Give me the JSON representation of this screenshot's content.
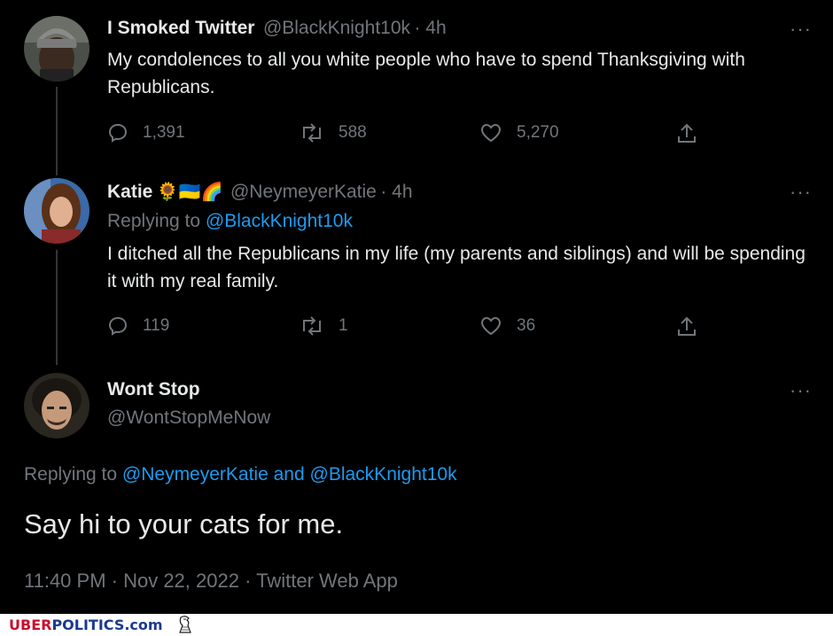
{
  "tweets": [
    {
      "name": "I Smoked Twitter",
      "handle": "@BlackKnight10k",
      "time": "· 4h",
      "text": "My condolences to all you white people who have to spend Thanksgiving with Republicans.",
      "replies": "1,391",
      "retweets": "588",
      "likes": "5,270"
    },
    {
      "name": "Katie",
      "emoji": "🌻🇺🇦🌈",
      "handle": "@NeymeyerKatie",
      "time": "· 4h",
      "replying_label": "Replying to",
      "replying_to": "@BlackKnight10k",
      "text": "I ditched all the Republicans in my life (my parents and siblings) and will be spending it with my real family.",
      "replies": "119",
      "retweets": "1",
      "likes": "36"
    }
  ],
  "main_tweet": {
    "name": "Wont Stop",
    "handle": "@WontStopMeNow",
    "replying_label": "Replying to",
    "replying_to_1": "@NeymeyerKatie",
    "replying_and": "and",
    "replying_to_2": "@BlackKnight10k",
    "text": "Say hi to your cats for me.",
    "timestamp": "11:40 PM · Nov 22, 2022 · Twitter Web App"
  },
  "more_label": "···",
  "footer": {
    "brand_uber": "UBER",
    "brand_politics": "POLITICS",
    "brand_com": ".com"
  },
  "colors": {
    "background": "#000000",
    "text": "#e7e9ea",
    "muted": "#71767b",
    "link": "#1d9bf0",
    "brand_red": "#c8102e",
    "brand_blue": "#1a3a8f"
  }
}
